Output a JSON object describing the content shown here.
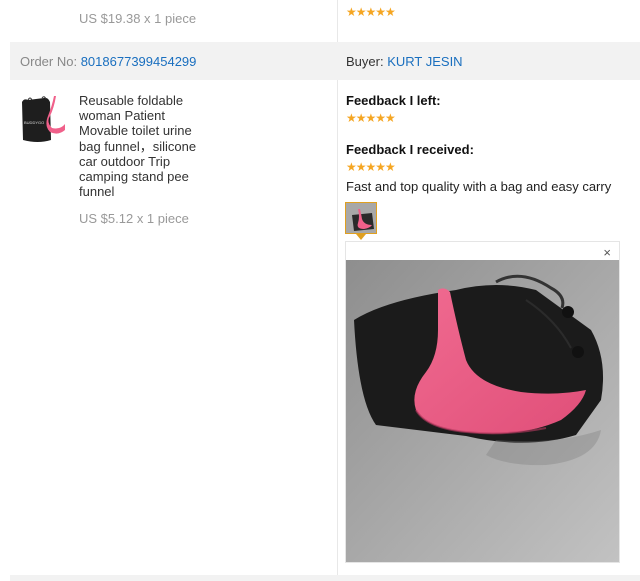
{
  "previous_item": {
    "price_line": "US $19.38 x 1 piece",
    "stars": "★★★★★"
  },
  "order": {
    "order_no_label": "Order No:",
    "order_no": "8018677399454299",
    "buyer_label": "Buyer:",
    "buyer_name": "KURT JESIN"
  },
  "product": {
    "thumb_brand": "BUDDYGO",
    "title": "Reusable foldable woman Patient Movable toilet urine bag funnel，silicone car outdoor Trip camping stand pee funnel",
    "price_line": "US $5.12 x 1 piece"
  },
  "feedback": {
    "left_label": "Feedback I left:",
    "left_stars": "★★★★★",
    "received_label": "Feedback I received:",
    "received_stars": "★★★★★",
    "comment": "Fast and top quality with a bag and easy carry",
    "close_glyph": "×"
  },
  "colors": {
    "link": "#1a6fbf",
    "star": "#f5a623",
    "order_bar_bg": "#f2f2f2",
    "thumb_border": "#e0a020",
    "funnel_pink": "#f0608a"
  },
  "icons": [
    "star-icon",
    "close-icon"
  ]
}
